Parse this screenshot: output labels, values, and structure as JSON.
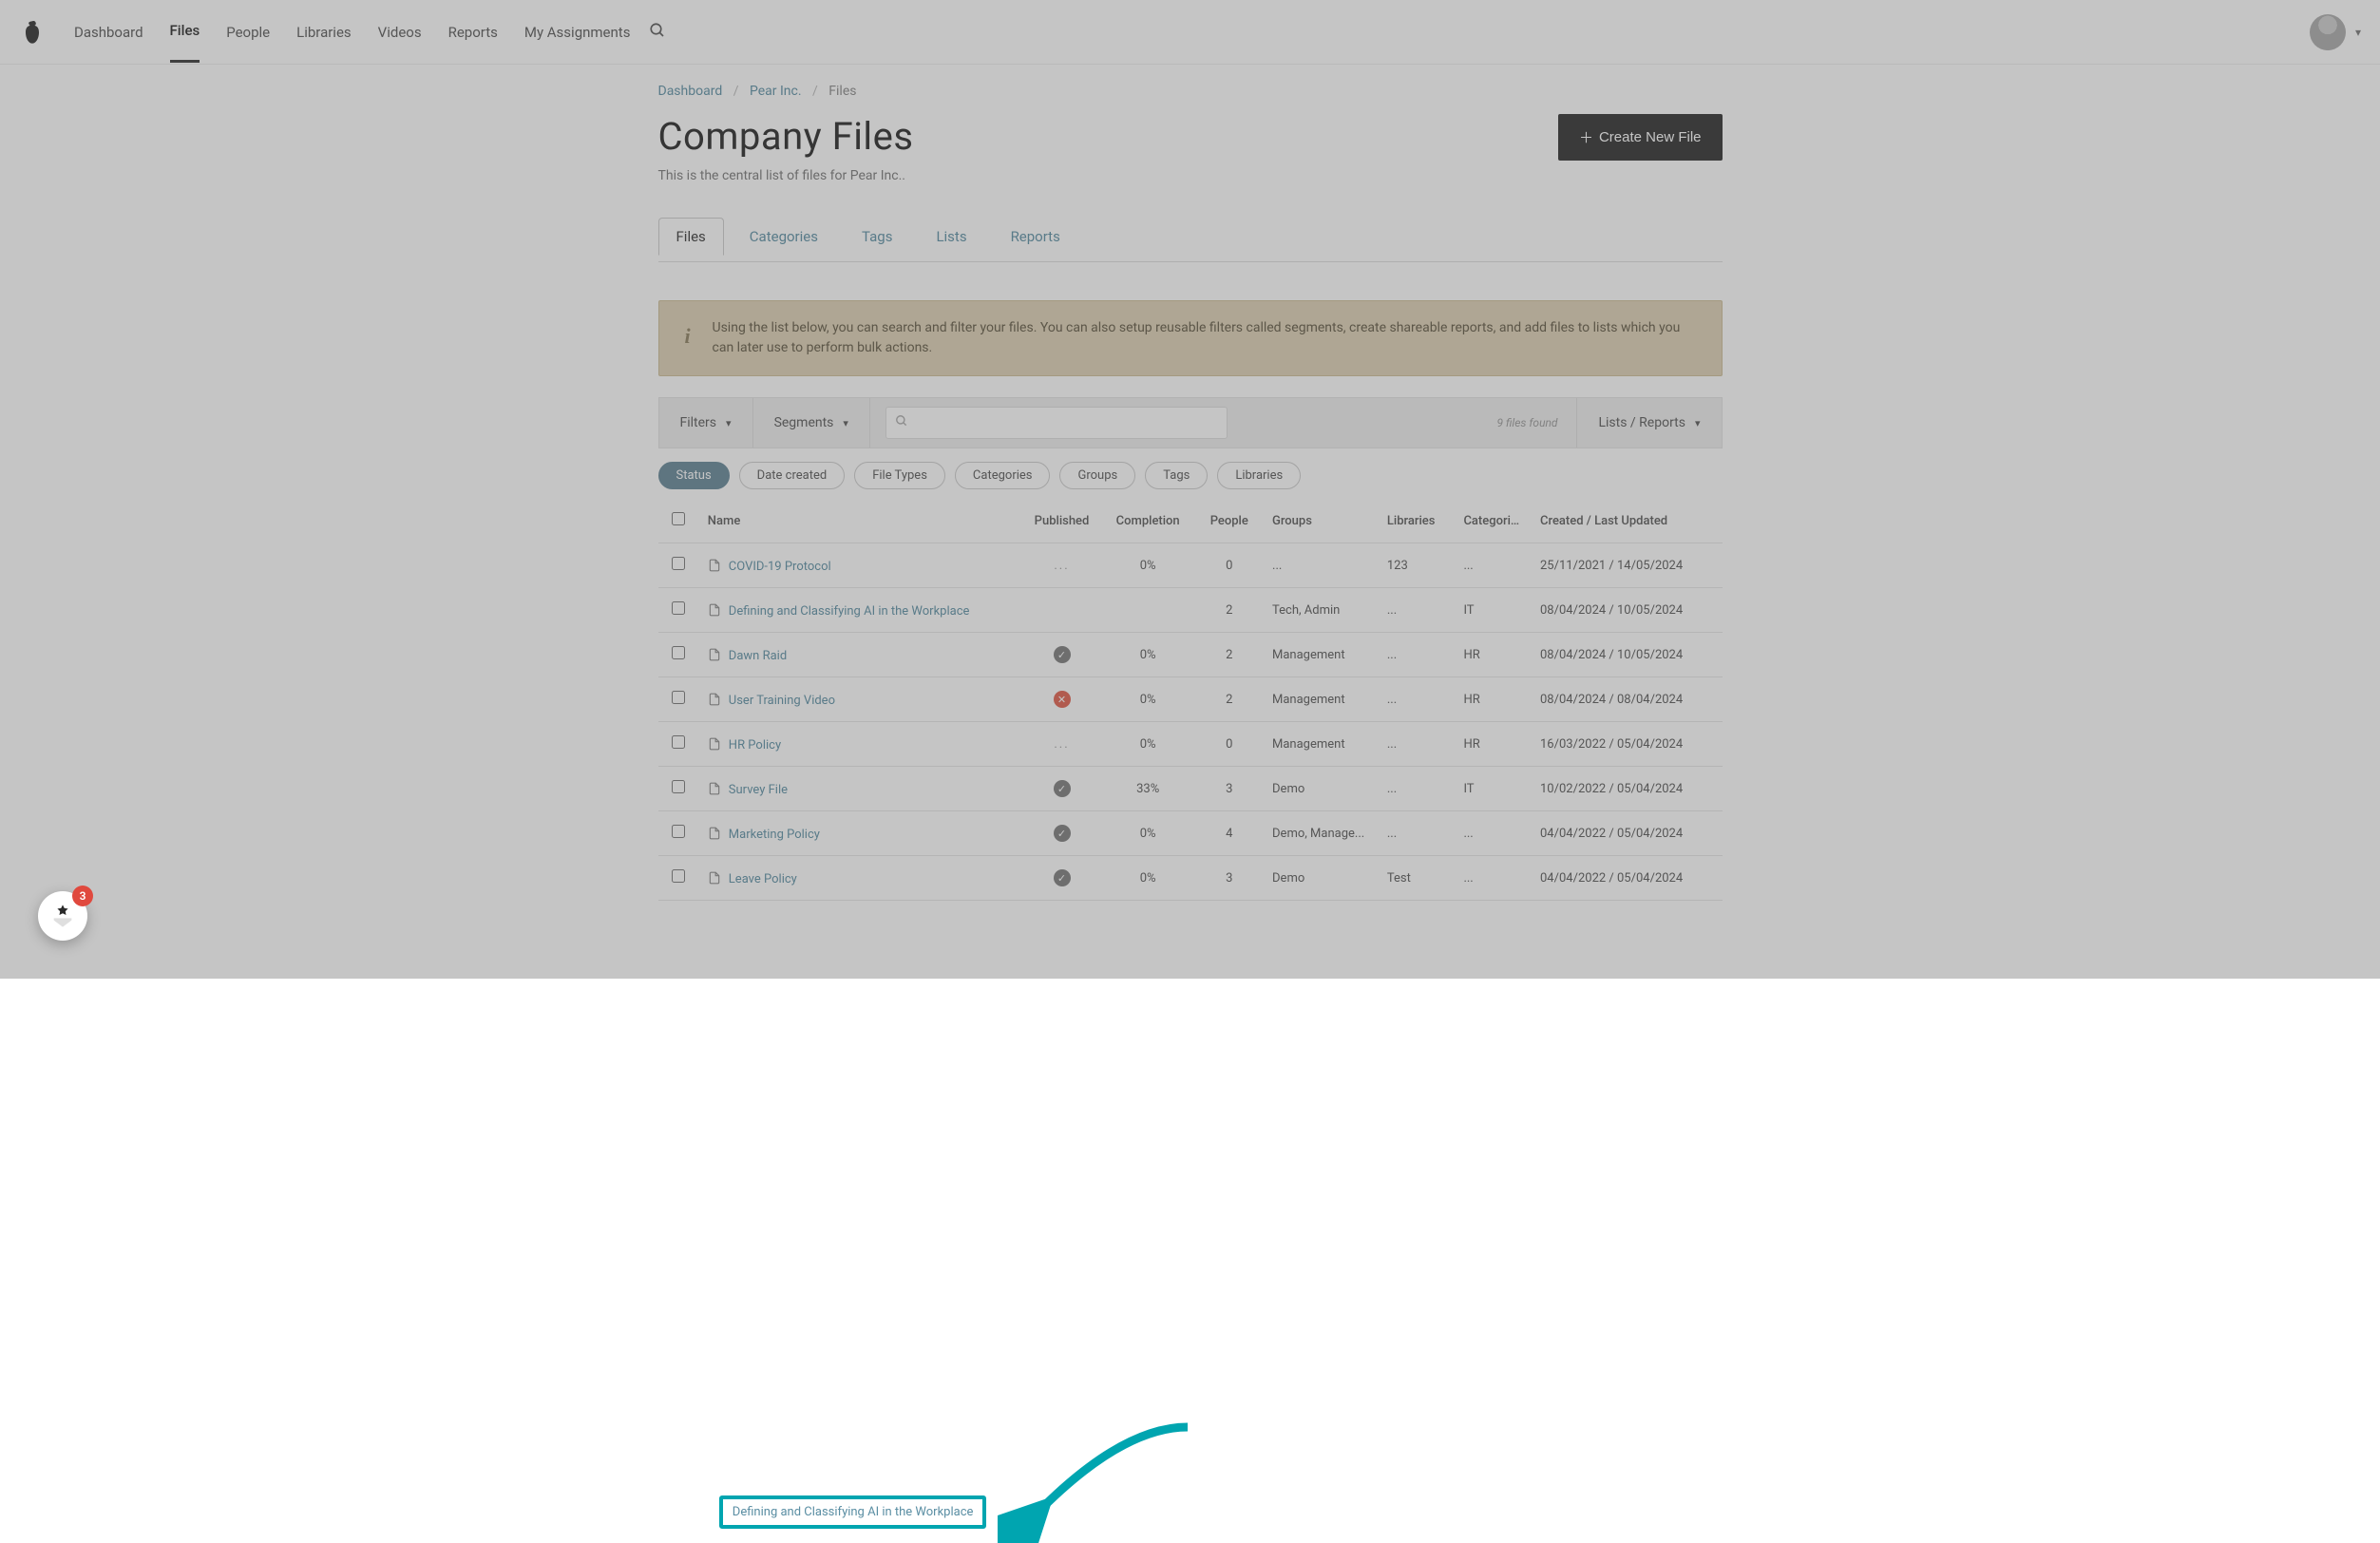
{
  "nav": {
    "items": [
      "Dashboard",
      "Files",
      "People",
      "Libraries",
      "Videos",
      "Reports",
      "My Assignments"
    ],
    "active_index": 1
  },
  "breadcrumb": {
    "dashboard": "Dashboard",
    "company": "Pear Inc.",
    "current": "Files"
  },
  "header": {
    "title": "Company Files",
    "subtitle": "This is the central list of files for Pear Inc..",
    "create_btn": "Create New File"
  },
  "tabs": {
    "items": [
      "Files",
      "Categories",
      "Tags",
      "Lists",
      "Reports"
    ],
    "active_index": 0
  },
  "info_text": "Using the list below, you can search and filter your files. You can also setup reusable filters called segments, create shareable reports, and add files to lists which you can later use to perform bulk actions.",
  "toolbar": {
    "filters": "Filters",
    "segments": "Segments",
    "found": "9 files found",
    "lists_reports": "Lists / Reports"
  },
  "chips": {
    "items": [
      "Status",
      "Date created",
      "File Types",
      "Categories",
      "Groups",
      "Tags",
      "Libraries"
    ],
    "active_index": 0
  },
  "table": {
    "columns": [
      "",
      "Name",
      "Published",
      "Completion",
      "People",
      "Groups",
      "Libraries",
      "Categories",
      "Created / Last Updated"
    ],
    "rows": [
      {
        "name": "COVID-19 Protocol",
        "published": "dots",
        "completion": "0%",
        "people": "0",
        "groups": "...",
        "libraries": "123",
        "categories": "...",
        "created": "25/11/2021 / 14/05/2024"
      },
      {
        "name": "Defining and Classifying AI in the Workplace",
        "published": "hidden",
        "completion": "hidden",
        "people": "2",
        "groups": "Tech, Admin",
        "libraries": "...",
        "categories": "IT",
        "created": "08/04/2024 / 10/05/2024",
        "highlight": true
      },
      {
        "name": "Dawn Raid",
        "published": "ok",
        "completion": "0%",
        "people": "2",
        "groups": "Management",
        "libraries": "...",
        "categories": "HR",
        "created": "08/04/2024 / 10/05/2024"
      },
      {
        "name": "User Training Video",
        "published": "no",
        "completion": "0%",
        "people": "2",
        "groups": "Management",
        "libraries": "...",
        "categories": "HR",
        "created": "08/04/2024 / 08/04/2024"
      },
      {
        "name": "HR Policy",
        "published": "dots",
        "completion": "0%",
        "people": "0",
        "groups": "Management",
        "libraries": "...",
        "categories": "HR",
        "created": "16/03/2022 / 05/04/2024"
      },
      {
        "name": "Survey File",
        "published": "ok",
        "completion": "33%",
        "people": "3",
        "groups": "Demo",
        "libraries": "...",
        "categories": "IT",
        "created": "10/02/2022 / 05/04/2024"
      },
      {
        "name": "Marketing Policy",
        "published": "ok",
        "completion": "0%",
        "people": "4",
        "groups": "Demo, Manage...",
        "libraries": "...",
        "categories": "...",
        "created": "04/04/2022 / 05/04/2024"
      },
      {
        "name": "Leave Policy",
        "published": "ok",
        "completion": "0%",
        "people": "3",
        "groups": "Demo",
        "libraries": "Test",
        "categories": "...",
        "created": "04/04/2022 / 05/04/2024"
      }
    ]
  },
  "intercom": {
    "count": "3"
  },
  "colors": {
    "accent": "#00a5b0",
    "link": "#5a8ea3"
  }
}
